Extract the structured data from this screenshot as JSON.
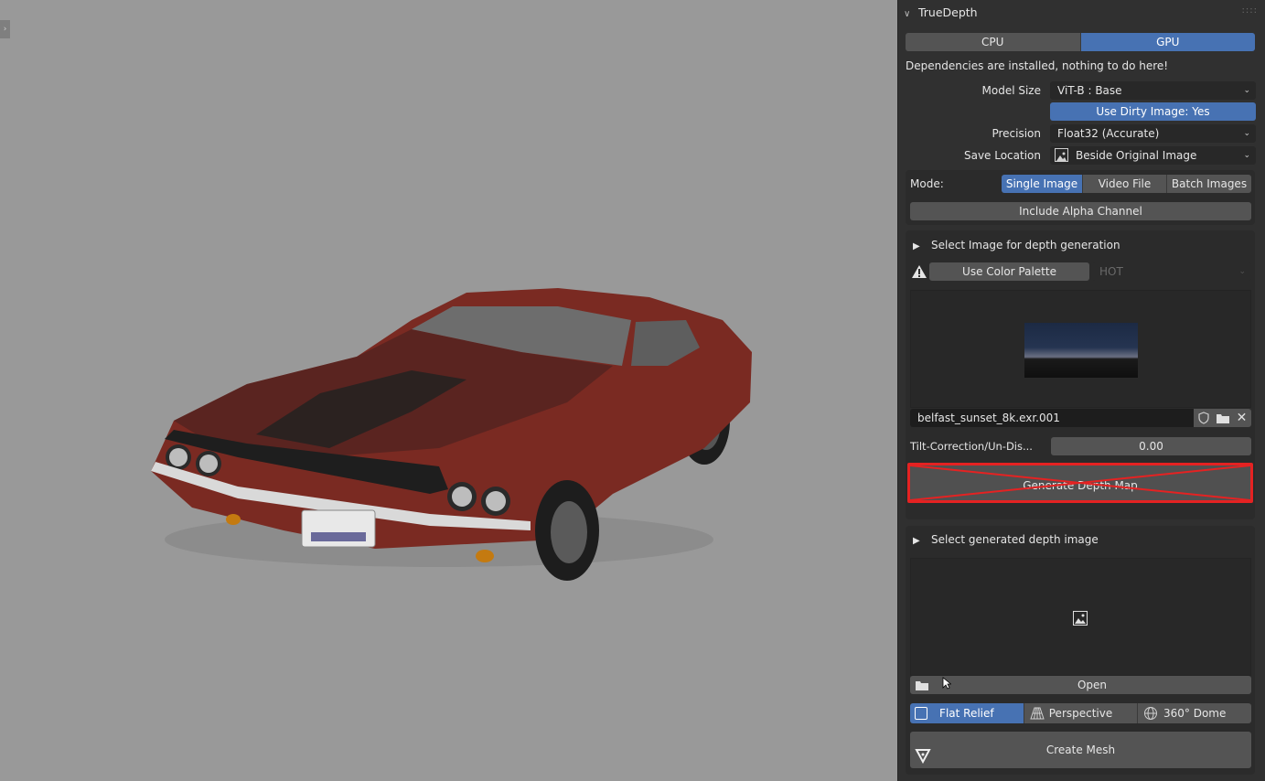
{
  "panel": {
    "title": "TrueDepth",
    "device_tabs": [
      {
        "label": "CPU",
        "active": false
      },
      {
        "label": "GPU",
        "active": true
      }
    ],
    "deps_status": "Dependencies are installed, nothing to do here!",
    "model_size": {
      "label": "Model Size",
      "value": "ViT-B : Base"
    },
    "dirty_image_button": "Use Dirty Image: Yes",
    "precision": {
      "label": "Precision",
      "value": "Float32 (Accurate)"
    },
    "save_location": {
      "label": "Save Location",
      "value": "Beside Original Image"
    },
    "mode": {
      "label": "Mode:",
      "options": [
        {
          "label": "Single Image",
          "active": true
        },
        {
          "label": "Video File",
          "active": false
        },
        {
          "label": "Batch Images",
          "active": false
        }
      ]
    },
    "include_alpha_button": "Include Alpha Channel",
    "select_image_header": "Select Image for depth generation",
    "color_palette_button": "Use Color Palette",
    "palette_value": "HOT",
    "image_filename": "belfast_sunset_8k.exr.001",
    "tilt": {
      "label": "Tilt-Correction/Un-Dis...",
      "value": "0.00"
    },
    "generate_button": "Generate Depth Map",
    "select_depth_header": "Select generated depth image",
    "open_button": "Open",
    "projection": [
      {
        "label": "Flat Relief",
        "icon": "square-icon",
        "active": true
      },
      {
        "label": "Perspective",
        "icon": "perspective-grid-icon",
        "active": false
      },
      {
        "label": "360° Dome",
        "icon": "globe-icon",
        "active": false
      }
    ],
    "create_mesh_button": "Create Mesh"
  },
  "colors": {
    "accent": "#4772b3",
    "panel_bg": "#303030",
    "viewport_bg": "#999999",
    "highlight_red": "#e52222"
  }
}
